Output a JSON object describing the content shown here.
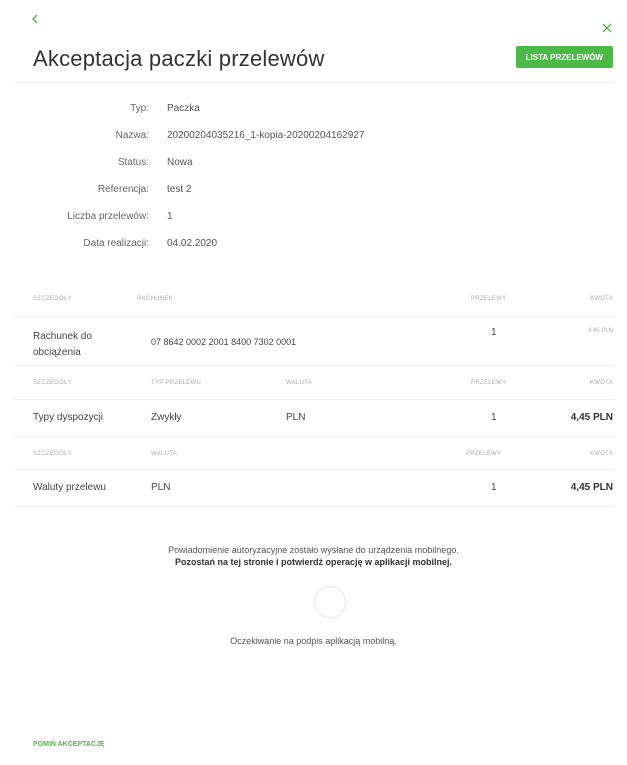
{
  "header": {
    "title": "Akceptacja paczki przelewów",
    "list_button": "LISTA PRZELEWÓW",
    "back_icon": "chevron-left-icon",
    "close_icon": "close-icon"
  },
  "info": [
    {
      "label": "Typ:",
      "value": "Paczka"
    },
    {
      "label": "Nazwa:",
      "value": "20200204035216_1-kopia-20200204162927"
    },
    {
      "label": "Status:",
      "value": "Nowa"
    },
    {
      "label": "Referencja:",
      "value": "test 2"
    },
    {
      "label": "Liczba przelewów:",
      "value": "1"
    },
    {
      "label": "Data realizacji:",
      "value": "04.02.2020"
    }
  ],
  "table1": {
    "headers": [
      "SZCZEGÓŁY",
      "RACHUNEK",
      "PRZELEWY",
      "KWOTA"
    ],
    "row": {
      "details": "Rachunek do obciążenia",
      "account": "07 8642 0002 2001 8400 7302 0001",
      "count": "1",
      "amount": "4,45 PLN"
    }
  },
  "table2": {
    "headers": [
      "SZCZEGÓŁY",
      "TYP PRZELEWU",
      "WALUTA",
      "PRZELEWY",
      "KWOTA"
    ],
    "row": {
      "details": "Typy dyspozycji",
      "type": "Zwykły",
      "currency": "PLN",
      "count": "1",
      "amount": "4,45 PLN"
    }
  },
  "table3": {
    "headers": [
      "SZCZEGÓŁY",
      "WALUTA",
      "PRZELEWY",
      "KWOTA"
    ],
    "row": {
      "details": "Waluty przelewu",
      "currency": "PLN",
      "count": "1",
      "amount": "4,45 PLN"
    }
  },
  "notice": {
    "line1": "Powiadomienie autoryzacyjne zostało wysłane do urządzenia mobilnego.",
    "line2": "Pozostań na tej stronie i potwierdź operację w aplikacji mobilnej.",
    "waiting": "Oczekiwanie na podpis aplikacją mobilną."
  },
  "footer": {
    "skip_link": "POMIŃ AKCEPTACJĘ"
  },
  "colors": {
    "accent": "#4cb848"
  }
}
